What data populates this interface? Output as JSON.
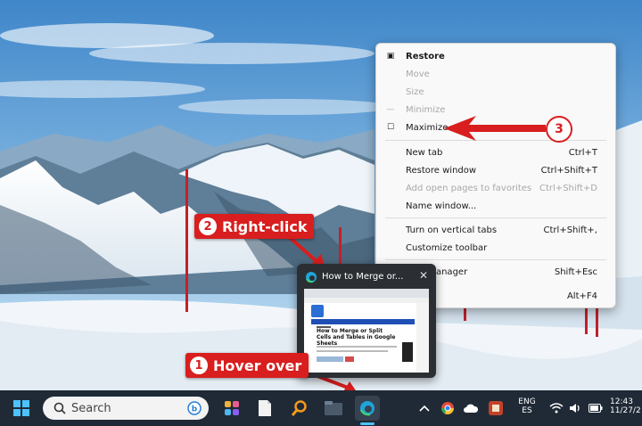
{
  "context_menu": {
    "items": [
      {
        "icon": "restore-icon",
        "label": "Restore",
        "shortcut": "",
        "state": "bold"
      },
      {
        "icon": "",
        "label": "Move",
        "shortcut": "",
        "state": "disabled"
      },
      {
        "icon": "",
        "label": "Size",
        "shortcut": "",
        "state": "disabled"
      },
      {
        "icon": "minimize-icon",
        "label": "Minimize",
        "shortcut": "",
        "state": "disabled"
      },
      {
        "icon": "maximize-icon",
        "label": "Maximize",
        "shortcut": "",
        "state": "normal"
      },
      {
        "icon": "",
        "label": "New tab",
        "shortcut": "Ctrl+T",
        "state": "normal"
      },
      {
        "icon": "",
        "label": "Restore window",
        "shortcut": "Ctrl+Shift+T",
        "state": "normal"
      },
      {
        "icon": "",
        "label": "Add open pages to favorites",
        "shortcut": "Ctrl+Shift+D",
        "state": "disabled"
      },
      {
        "icon": "",
        "label": "Name window...",
        "shortcut": "",
        "state": "normal"
      },
      {
        "icon": "",
        "label": "Turn on vertical tabs",
        "shortcut": "Ctrl+Shift+,",
        "state": "normal"
      },
      {
        "icon": "",
        "label": "Customize toolbar",
        "shortcut": "",
        "state": "normal"
      },
      {
        "icon": "",
        "label": "task manager",
        "shortcut": "Shift+Esc",
        "state": "normal"
      },
      {
        "icon": "",
        "label": "",
        "shortcut": "Alt+F4",
        "state": "normal"
      }
    ]
  },
  "preview": {
    "title": "How to Merge or...",
    "close_glyph": "✕",
    "page_heading": "How to Merge or Split Cells and Tables in Google Sheets"
  },
  "callouts": {
    "hover": {
      "number": "1",
      "label": "Hover over"
    },
    "right_click": {
      "number": "2",
      "label": "Right-click"
    },
    "maximize": {
      "number": "3"
    }
  },
  "taskbar": {
    "search_label": "Search",
    "language_line1": "ENG",
    "language_line2": "ES",
    "time": "12:43",
    "date": "11/27/2"
  },
  "colors": {
    "accent_red": "#d81e1e",
    "taskbar_bg": "#1f2a36",
    "menu_bg": "#f9f9f9"
  }
}
